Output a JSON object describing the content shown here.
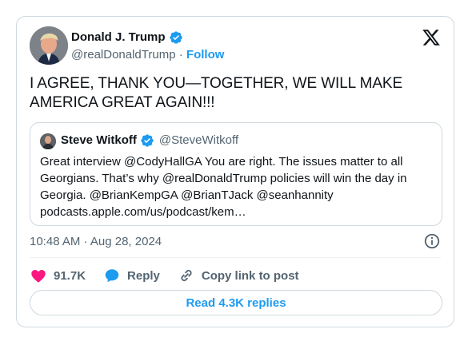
{
  "author": {
    "name": "Donald J. Trump",
    "handle": "@realDonaldTrump",
    "separator": "·",
    "follow_label": "Follow",
    "avatar_icon": "avatar-portrait"
  },
  "logo_icon": "x-logo-icon",
  "tweet": {
    "text": "I AGREE, THANK YOU—TOGETHER, WE WILL MAKE AMERICA GREAT AGAIN!!!"
  },
  "quote": {
    "name": "Steve Witkoff",
    "handle": "@SteveWitkoff",
    "text": "Great interview @CodyHallGA You are right. The issues matter to all Georgians. That’s why @realDonaldTrump policies will win the day in Georgia. @BrianKempGA @BrianTJack @seanhannity podcasts.apple.com/us/podcast/kem…"
  },
  "timestamp": "10:48 AM · Aug 28, 2024",
  "actions": {
    "likes": "91.7K",
    "reply_label": "Reply",
    "copy_label": "Copy link to post"
  },
  "read_replies_label": "Read 4.3K replies",
  "colors": {
    "accent": "#1d9bf0",
    "like": "#f91880",
    "text": "#0f1419",
    "muted": "#536471",
    "border": "#cfd9de"
  }
}
